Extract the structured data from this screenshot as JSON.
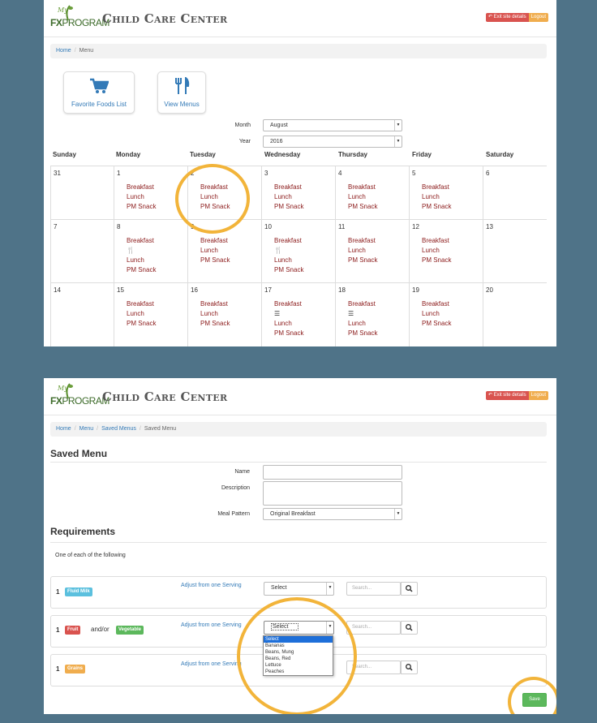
{
  "site": {
    "logo_my": "My",
    "logo_fx": "FX",
    "logo_program": "PROGRAM",
    "title": "Child Care Center",
    "exit_label": "Exit site details",
    "logout_label": "Logout"
  },
  "screen1": {
    "breadcrumb": {
      "home": "Home",
      "current": "Menu"
    },
    "tiles": {
      "favorites": "Favorite Foods List",
      "view_menus": "View Menus"
    },
    "month_label": "Month",
    "month_value": "August",
    "year_label": "Year",
    "year_value": "2016",
    "days": [
      "Sunday",
      "Monday",
      "Tuesday",
      "Wednesday",
      "Thursday",
      "Friday",
      "Saturday"
    ],
    "meals": {
      "breakfast": "Breakfast",
      "lunch": "Lunch",
      "snack": "PM Snack"
    },
    "weeks": [
      {
        "dates": [
          "31",
          "1",
          "2",
          "3",
          "4",
          "5",
          "6"
        ]
      },
      {
        "dates": [
          "7",
          "8",
          "9",
          "10",
          "11",
          "12",
          "13"
        ]
      },
      {
        "dates": [
          "14",
          "15",
          "16",
          "17",
          "18",
          "19",
          "20"
        ]
      }
    ]
  },
  "screen2": {
    "breadcrumb": {
      "home": "Home",
      "menu": "Menu",
      "saved": "Saved Menus",
      "current": "Saved Menu"
    },
    "heading": "Saved Menu",
    "name_label": "Name",
    "description_label": "Description",
    "pattern_label": "Meal Pattern",
    "pattern_value": "Original Breakfast",
    "req_heading": "Requirements",
    "req_note": "One of each of the following",
    "adjust_label": "Adjust from one Serving",
    "select_value": "Select",
    "search_placeholder": "Search...",
    "rows": [
      {
        "qty": "1",
        "badge": "Fluid Milk"
      },
      {
        "qty": "1",
        "badge": "Fruit",
        "joiner": "and/or",
        "badge2": "Vegetable"
      },
      {
        "qty": "1",
        "badge": "Grains"
      }
    ],
    "dropdown_options": [
      "Select",
      "Bananas",
      "Beans, Mung",
      "Beans, Red",
      "Lettuce",
      "Peaches"
    ],
    "save_label": "Save"
  },
  "colors": {
    "badge_milk": "#5bc0de",
    "badge_fruit": "#d9534f",
    "badge_veg": "#5cb85c",
    "badge_grains": "#f0ad4e",
    "highlight_ring": "#f2b43a"
  }
}
